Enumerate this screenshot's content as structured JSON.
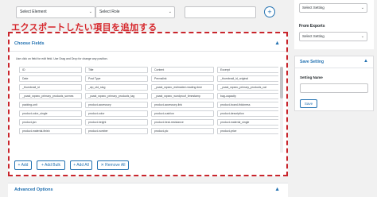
{
  "top": {
    "select_element": "Select Element",
    "select_role": "Select Role",
    "add_symbol": "+"
  },
  "annotation": "エクスポートしたい項目を追加する",
  "panel": {
    "title": "Choose Fields",
    "hint": "Use click on field for edit field. Use Drag and Drop for change any position.",
    "fields": [
      "ID",
      "Title",
      "Content",
      "Excerpt",
      "Date",
      "Post Type",
      "Permalink",
      "_thumbnail_id_original",
      "_thumbnail_id",
      "_wp_old_slug",
      "_yoast_wpseo_estimated-reading-time",
      "_yoast_wpseo_primary_products_cat",
      "_yoast_wpseo_primary_products_scenes",
      "_yoast_wpseo_primary_products_tag",
      "_yoast_wpseo_wordproof_timestamp",
      "bag-capacity",
      "packing-unit",
      "product-accessory",
      "product-accessory-link",
      "product-board-thickness",
      "product-color_single",
      "product-color",
      "product-cushion",
      "product-description",
      "product-jan",
      "product-height",
      "product-heat-resistance",
      "product-material_single",
      "product-material-finish",
      "product-number",
      "product-pic",
      "product-price"
    ],
    "buttons": {
      "add": "+ Add",
      "add_bulk": "+ Add Bulk",
      "add_all": "+ Add All",
      "remove_all": "✕ Remove All"
    },
    "caret": "▲"
  },
  "advanced": {
    "label": "Advanced Options",
    "caret": "▲"
  },
  "right": {
    "select_setting_1": "Select Setting",
    "from_exports": "From Exports",
    "select_setting_2": "Select Setting",
    "save_setting_title": "Save Setting",
    "setting_name_label": "Setting Name",
    "save_button": "Save",
    "caret": "▲",
    "chevron": "⌄"
  }
}
